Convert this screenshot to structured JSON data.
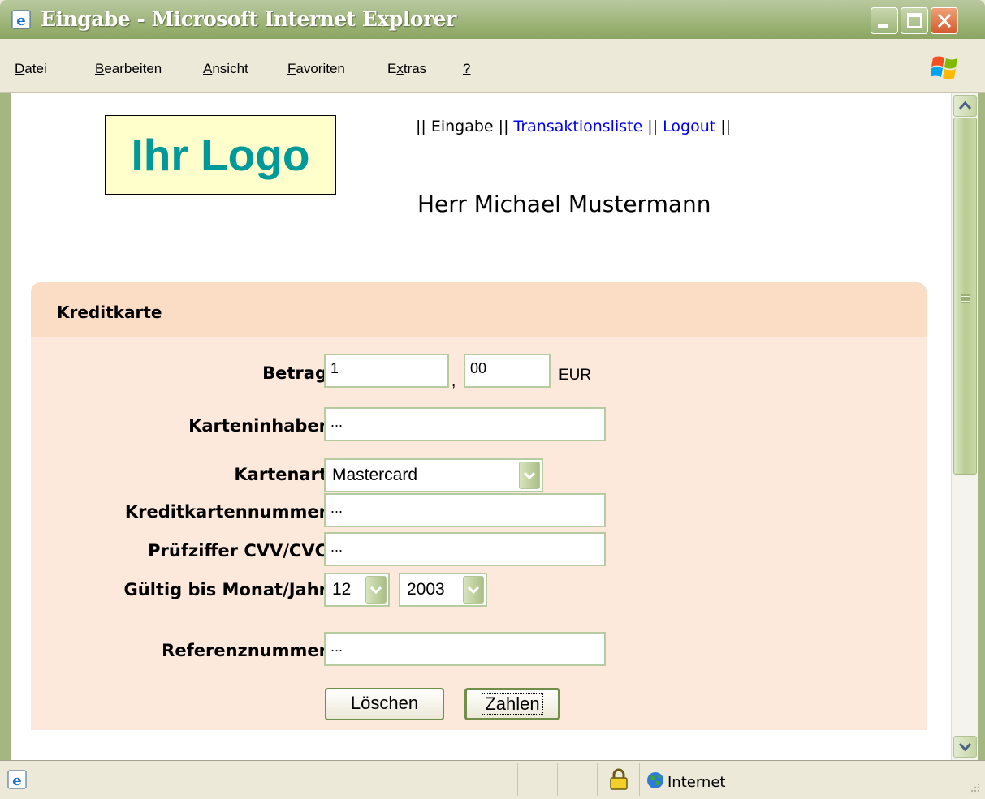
{
  "window": {
    "title": "Eingabe - Microsoft Internet Explorer"
  },
  "menu": {
    "items": [
      {
        "label": "Datei",
        "accel": "D"
      },
      {
        "label": "Bearbeiten",
        "accel": "B"
      },
      {
        "label": "Ansicht",
        "accel": "A"
      },
      {
        "label": "Favoriten",
        "accel": "F"
      },
      {
        "label": "Extras",
        "accel": "x"
      },
      {
        "label": "?",
        "accel": "?"
      }
    ]
  },
  "page": {
    "logo_text": "Ihr Logo",
    "nav": {
      "sep_open": "|| ",
      "current": "Eingabe",
      "sep1": " || ",
      "link_transactions": "Transaktionsliste",
      "sep2": " || ",
      "link_logout": "Logout",
      "sep_close": " ||"
    },
    "user_name": "Herr Michael Mustermann"
  },
  "form": {
    "title": "Kreditkarte",
    "amount": {
      "label": "Betrag",
      "whole": "1",
      "separator": ",",
      "cents": "00",
      "currency": "EUR"
    },
    "holder": {
      "label": "Karteninhaber",
      "value": "..."
    },
    "card_type": {
      "label": "Kartenart",
      "value": "Mastercard"
    },
    "card_number": {
      "label": "Kreditkartennummer",
      "value": "..."
    },
    "cvv": {
      "label": "Prüfziffer CVV/CVC",
      "value": "..."
    },
    "expiry": {
      "label": "Gültig bis Monat/Jahr",
      "month": "12",
      "year": "2003"
    },
    "reference": {
      "label": "Referenznummer",
      "value": "..."
    },
    "buttons": {
      "clear": "Löschen",
      "pay": "Zahlen"
    }
  },
  "status": {
    "zone": "Internet"
  },
  "colors": {
    "logo_text": "#009999",
    "logo_bg": "#ffffcc",
    "panel_bg": "#fde9dc",
    "panel_header": "#fbdcc5",
    "link": "#0000ee"
  }
}
